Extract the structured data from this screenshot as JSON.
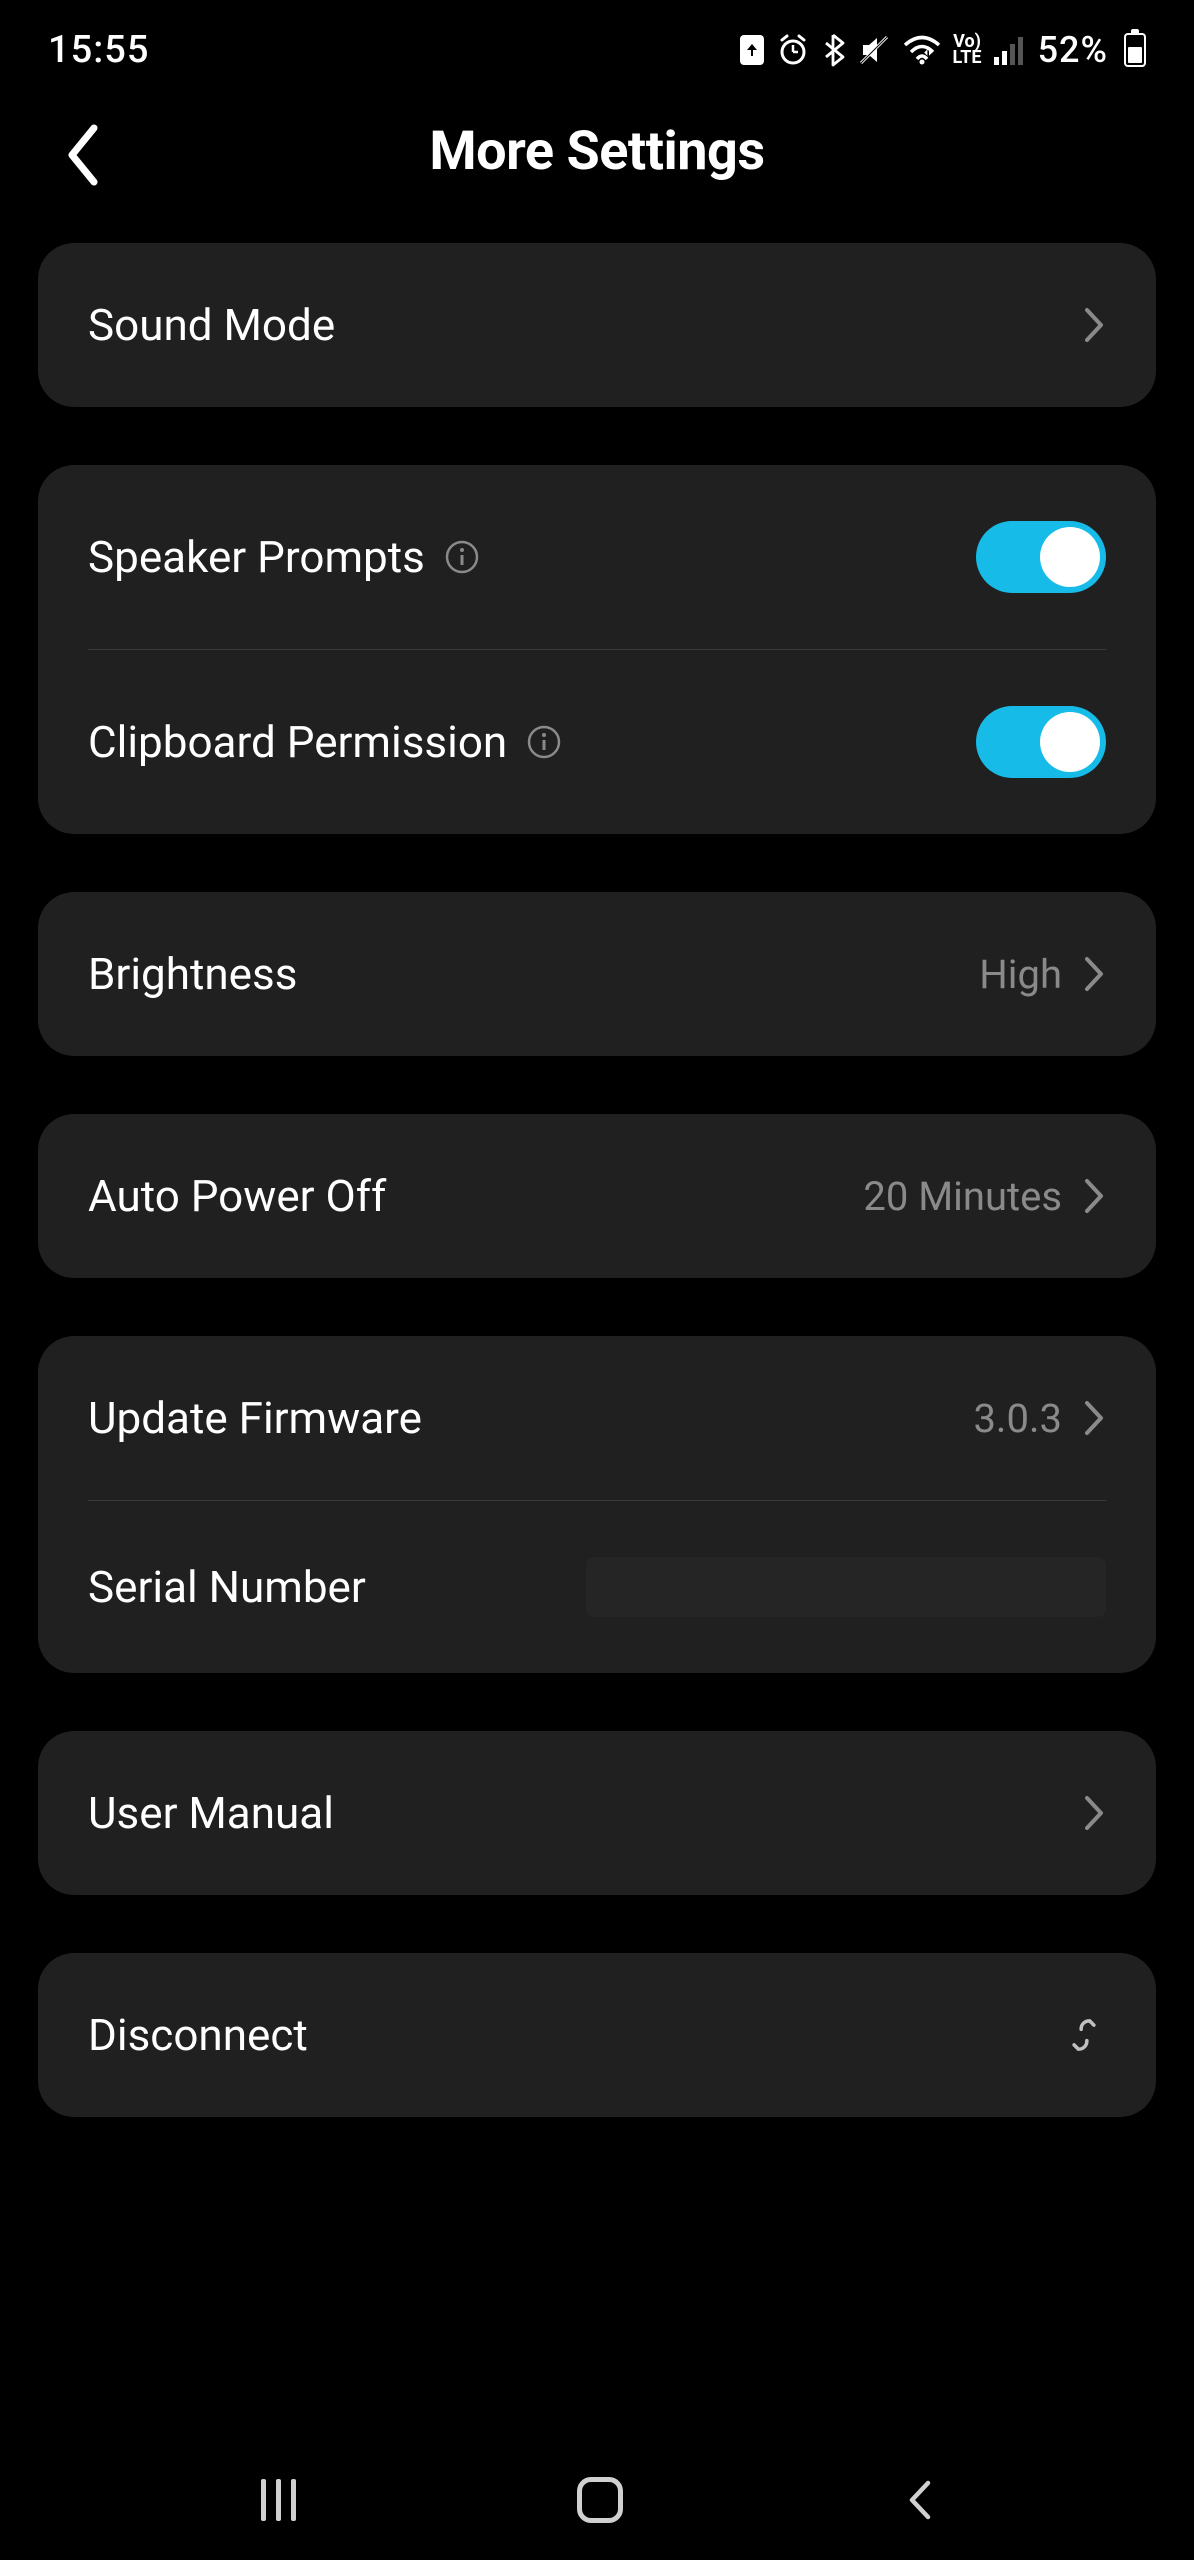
{
  "status": {
    "time": "15:55",
    "battery_pct": "52%"
  },
  "header": {
    "title": "More Settings"
  },
  "rows": {
    "sound_mode": {
      "label": "Sound Mode"
    },
    "speaker_prompts": {
      "label": "Speaker Prompts",
      "enabled": true
    },
    "clipboard_permission": {
      "label": "Clipboard Permission",
      "enabled": true
    },
    "brightness": {
      "label": "Brightness",
      "value": "High"
    },
    "auto_power_off": {
      "label": "Auto Power Off",
      "value": "20 Minutes"
    },
    "update_firmware": {
      "label": "Update Firmware",
      "value": "3.0.3"
    },
    "serial_number": {
      "label": "Serial Number",
      "value": ""
    },
    "user_manual": {
      "label": "User Manual"
    },
    "disconnect": {
      "label": "Disconnect"
    }
  },
  "colors": {
    "accent": "#16bbe8",
    "card_bg": "#202020",
    "secondary_text": "#8a8a8a"
  }
}
